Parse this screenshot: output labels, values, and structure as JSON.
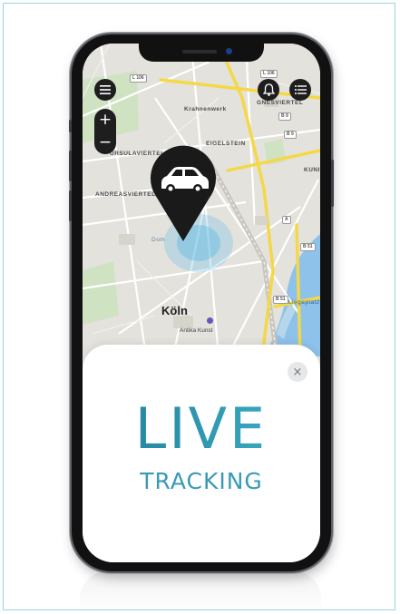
{
  "map": {
    "labels": {
      "ursulaviertel": "URSULAVIERTEL",
      "eigelstein": "EIGELSTEIN",
      "kuni": "KUNI",
      "andreasviertel": "ANDREASVIERTEL",
      "city": "Köln",
      "poi": "Antika Kunst",
      "gnesviertel": "GNESVIERTEL",
      "krahnenwerk": "Krahnenwerk",
      "liegeplatz": "Liegeplatz",
      "dom": "Dom"
    },
    "road_tags": {
      "l106a": "L 106",
      "l106b": "L 106",
      "b9a": "B 9",
      "b9b": "B 9",
      "b51a": "B 51",
      "b51b": "B 51",
      "a": "A"
    },
    "zoom_in": "+",
    "zoom_out": "−"
  },
  "card": {
    "close_glyph": "×",
    "headline": "LIVE",
    "subheadline": "TRACKING"
  },
  "icons": {
    "menu": "menu-icon",
    "bell": "bell-icon",
    "list": "list-icon",
    "pin": "car-location-pin-icon"
  },
  "colors": {
    "accent": "#2f93ad",
    "pin": "#1a1a1a",
    "pulse": "#49b4e6",
    "road": "#f4d848"
  }
}
